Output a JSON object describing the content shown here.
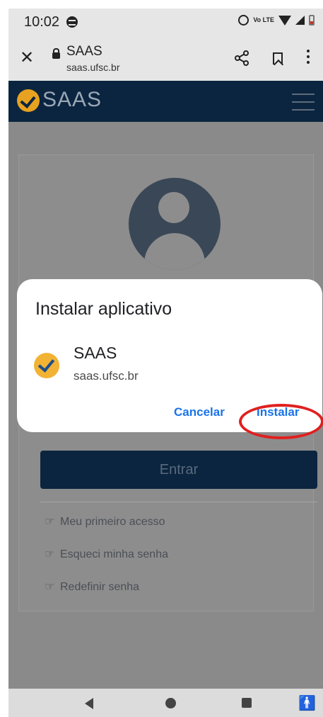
{
  "status_bar": {
    "time": "10:02",
    "lte_label": "Vo LTE"
  },
  "browser": {
    "page_title": "SAAS",
    "host": "saas.ufsc.br"
  },
  "app_header": {
    "logo_text": "SAAS"
  },
  "login_card": {
    "submit_label": "Entrar",
    "links": [
      "Meu primeiro acesso",
      "Esqueci minha senha",
      "Redefinir senha"
    ]
  },
  "install_dialog": {
    "title": "Instalar aplicativo",
    "app_name": "SAAS",
    "app_host": "saas.ufsc.br",
    "cancel_label": "Cancelar",
    "install_label": "Instalar"
  },
  "colors": {
    "accent_blue": "#1a73e8",
    "brand_navy": "#0b2540",
    "brand_yellow": "#f2b233",
    "highlight_red": "#e0201f"
  }
}
